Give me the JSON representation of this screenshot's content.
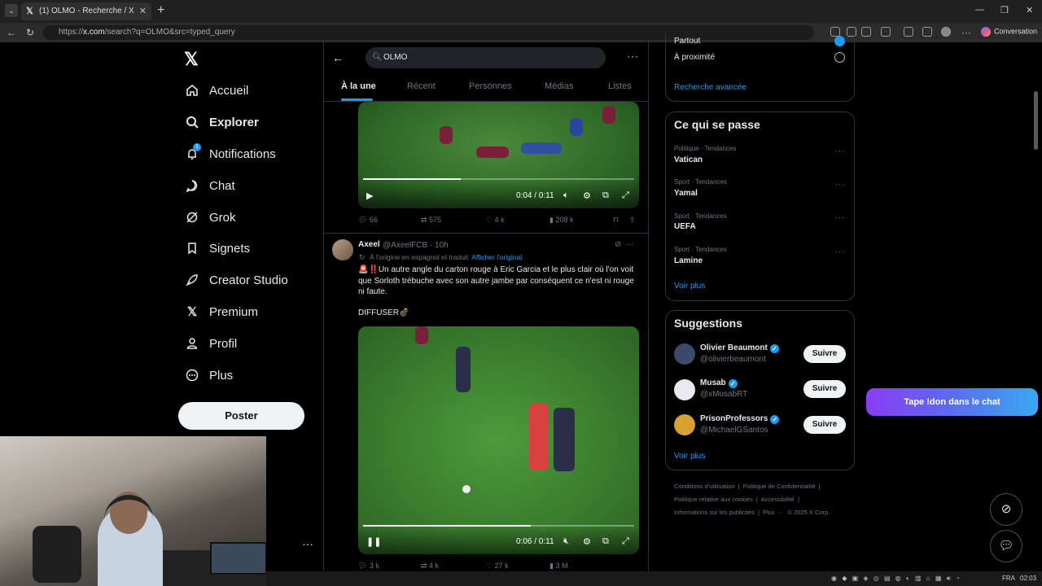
{
  "browser": {
    "tab_title": "(1) OLMO - Recherche / X",
    "url_prefix": "https://",
    "url_domain": "x.com",
    "url_path": "/search?q=OLMO&src=typed_query",
    "conversation_label": "Conversation"
  },
  "nav": {
    "items": [
      {
        "label": "Accueil",
        "icon": "home-icon"
      },
      {
        "label": "Explorer",
        "icon": "search-icon"
      },
      {
        "label": "Notifications",
        "icon": "bell-icon",
        "badge": "1"
      },
      {
        "label": "Chat",
        "icon": "chat-icon"
      },
      {
        "label": "Grok",
        "icon": "grok-icon"
      },
      {
        "label": "Signets",
        "icon": "bookmark-icon"
      },
      {
        "label": "Creator Studio",
        "icon": "rocket-icon"
      },
      {
        "label": "Premium",
        "icon": "x-icon"
      },
      {
        "label": "Profil",
        "icon": "user-icon"
      },
      {
        "label": "Plus",
        "icon": "more-circle-icon"
      }
    ],
    "post_label": "Poster"
  },
  "search": {
    "query": "OLMO",
    "tabs": [
      "À la une",
      "Récent",
      "Personnes",
      "Médias",
      "Listes"
    ],
    "active_tab": "À la une"
  },
  "video1": {
    "time": "0:04 / 0:11",
    "progress": 0.36,
    "replies": "66",
    "reposts": "575",
    "likes": "4 k",
    "views": "208 k"
  },
  "tweet": {
    "name": "Axeel",
    "handle": "@AxeelFCB · 10h",
    "translated_note": "À l'origine en espagnol et traduit",
    "show_original": "Afficher l'original",
    "text": "🚨‼️Un autre angle du carton rouge à Eric Garcia et le plus clair où l'on voit que Sorloth trébuche avec son autre jambe par conséquent ce n'est ni rouge ni faute.",
    "diffuse": "DIFFUSER💣"
  },
  "video2": {
    "time": "0:06 / 0:11",
    "progress": 0.62,
    "replies": "3 k",
    "reposts": "4 k",
    "likes": "27 k",
    "views": "3 M"
  },
  "right": {
    "location_cut": "Partout",
    "proximity": "À proximité",
    "advanced_search": "Recherche avancée",
    "happening_title": "Ce qui se passe",
    "trends": [
      {
        "category": "Politique · Tendances",
        "name": "Vatican"
      },
      {
        "category": "Sport · Tendances",
        "name": "Yamal"
      },
      {
        "category": "Sport · Tendances",
        "name": "UEFA"
      },
      {
        "category": "Sport · Tendances",
        "name": "Lamine"
      }
    ],
    "see_more": "Voir plus",
    "suggestions_title": "Suggestions",
    "suggestions": [
      {
        "name": "Olivier Beaumont",
        "handle": "@olivierbeaumont",
        "avatar_color": "#3a4a6a"
      },
      {
        "name": "Musab",
        "handle": "@xMusabRT",
        "avatar_color": "#e8e8ee"
      },
      {
        "name": "PrisonProfessors",
        "handle": "@MichaelGSantos",
        "avatar_color": "#d8a030"
      }
    ],
    "follow_label": "Suivre",
    "footer_line1": [
      "Conditions d'utilisation",
      "Politique de Confidentialité"
    ],
    "footer_line2": [
      "Politique relative aux cookies",
      "Accessibilité"
    ],
    "footer_line3": [
      "Informations sur les publicités",
      "Plus ···",
      "© 2025 X Corp."
    ]
  },
  "overlay": {
    "label": "Tape !don dans le chat"
  },
  "taskbar": {
    "lang": "FRA",
    "time": "02:03"
  },
  "colors": {
    "accent": "#1d9bf0",
    "background": "#000000",
    "overlay_gradient_start": "#8a3cf5"
  }
}
